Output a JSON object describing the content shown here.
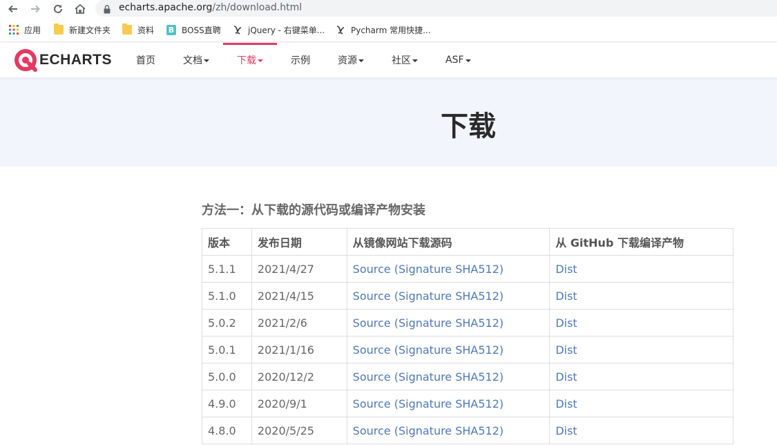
{
  "browser": {
    "url_host": "echarts.apache.org",
    "url_path": "/zh/download.html"
  },
  "bookmarks": [
    {
      "label": "应用",
      "icon": "apps-grid-icon"
    },
    {
      "label": "新建文件夹",
      "icon": "folder-icon"
    },
    {
      "label": "资料",
      "icon": "folder-icon"
    },
    {
      "label": "BOSS直聘",
      "icon": "boss-b-icon"
    },
    {
      "label": "jQuery - 右键菜单...",
      "icon": "bookmark-site-icon"
    },
    {
      "label": "Pycharm 常用快捷...",
      "icon": "bookmark-site-icon"
    }
  ],
  "site": {
    "logo_text": "ECHARTS",
    "menu": [
      {
        "label": "首页",
        "dropdown": false
      },
      {
        "label": "文档",
        "dropdown": true
      },
      {
        "label": "下载",
        "dropdown": true,
        "active": true
      },
      {
        "label": "示例",
        "dropdown": false
      },
      {
        "label": "资源",
        "dropdown": true
      },
      {
        "label": "社区",
        "dropdown": true
      },
      {
        "label": "ASF",
        "dropdown": true
      }
    ],
    "accent_color": "#e43961"
  },
  "hero": {
    "title": "下载"
  },
  "content": {
    "section_title": "方法一：从下载的源代码或编译产物安装",
    "table": {
      "headers": [
        "版本",
        "发布日期",
        "从镜像网站下载源码",
        "从 GitHub 下载编译产物"
      ],
      "rows": [
        {
          "version": "5.1.1",
          "date": "2021/4/27",
          "source": "Source",
          "signature": "(Signature SHA512)",
          "dist": "Dist"
        },
        {
          "version": "5.1.0",
          "date": "2021/4/15",
          "source": "Source",
          "signature": "(Signature SHA512)",
          "dist": "Dist"
        },
        {
          "version": "5.0.2",
          "date": "2021/2/6",
          "source": "Source",
          "signature": "(Signature SHA512)",
          "dist": "Dist"
        },
        {
          "version": "5.0.1",
          "date": "2021/1/16",
          "source": "Source",
          "signature": "(Signature SHA512)",
          "dist": "Dist"
        },
        {
          "version": "5.0.0",
          "date": "2020/12/2",
          "source": "Source",
          "signature": "(Signature SHA512)",
          "dist": "Dist"
        },
        {
          "version": "4.9.0",
          "date": "2020/9/1",
          "source": "Source",
          "signature": "(Signature SHA512)",
          "dist": "Dist"
        },
        {
          "version": "4.8.0",
          "date": "2020/5/25",
          "source": "Source",
          "signature": "(Signature SHA512)",
          "dist": "Dist"
        }
      ]
    },
    "link_color": "#4e79b6"
  }
}
